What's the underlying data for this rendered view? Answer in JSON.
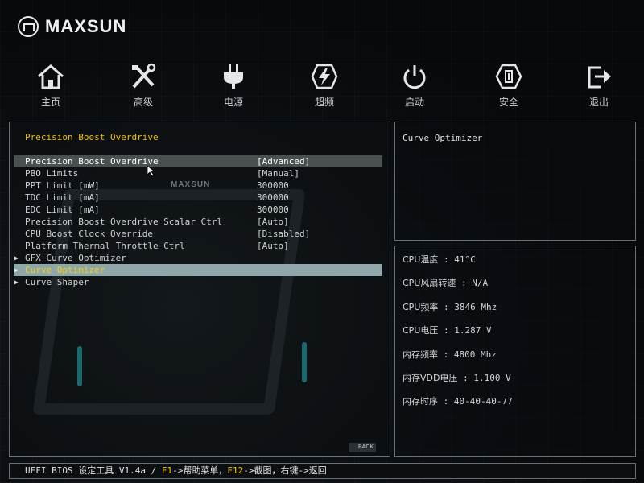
{
  "brand": {
    "name": "MAXSUN"
  },
  "nav": [
    {
      "label": "主页",
      "icon": "home-icon"
    },
    {
      "label": "高级",
      "icon": "tools-icon"
    },
    {
      "label": "电源",
      "icon": "power-plug-icon"
    },
    {
      "label": "超频",
      "icon": "lightning-icon"
    },
    {
      "label": "启动",
      "icon": "power-button-icon"
    },
    {
      "label": "安全",
      "icon": "shield-icon"
    },
    {
      "label": "退出",
      "icon": "exit-icon"
    }
  ],
  "main": {
    "section_title": "Precision Boost Overdrive",
    "items": [
      {
        "label": "Precision Boost Overdrive",
        "value": "[Advanced]"
      },
      {
        "label": "PBO Limits",
        "value": "[Manual]"
      },
      {
        "label": "PPT Limit [mW]",
        "value": "300000"
      },
      {
        "label": "TDC Limit [mA]",
        "value": "300000"
      },
      {
        "label": "EDC Limit [mA]",
        "value": "300000"
      },
      {
        "label": "Precision Boost Overdrive Scalar Ctrl",
        "value": "[Auto]"
      },
      {
        "label": "CPU Boost Clock Override",
        "value": "[Disabled]"
      },
      {
        "label": "Platform Thermal Throttle Ctrl",
        "value": "[Auto]"
      },
      {
        "label": "GFX Curve Optimizer",
        "value": ""
      },
      {
        "label": "Curve Optimizer",
        "value": ""
      },
      {
        "label": "Curve Shaper",
        "value": ""
      }
    ],
    "background_word": "MAXSUN",
    "back_label": "BACK"
  },
  "help": {
    "text": "Curve Optimizer"
  },
  "info": {
    "cpu_temp_label": "CPU温度",
    "cpu_temp_value": "41°C",
    "cpu_fan_label": "CPU风扇转速",
    "cpu_fan_value": "N/A",
    "cpu_freq_label": "CPU频率",
    "cpu_freq_value": "3846 Mhz",
    "cpu_volt_label": "CPU电压",
    "cpu_volt_value": "1.287 V",
    "mem_freq_label": "内存频率",
    "mem_freq_value": "4800 Mhz",
    "mem_vdd_label": "内存VDD电压",
    "mem_vdd_value": "1.100 V",
    "mem_timing_label": "内存时序",
    "mem_timing_value": "40-40-40-77",
    "separator": " : "
  },
  "status": {
    "prefix": "UEFI BIOS 设定工具 V1.4a / ",
    "f1": "F1",
    "f1_text": "->帮助菜单，",
    "f12": "F12",
    "f12_text": "->截图，右键->返回"
  },
  "colors": {
    "accent": "#f0c000",
    "selected_bg": "#8fa7a8",
    "hover_bg": "#4a4f52",
    "border": "#6a6f73"
  }
}
